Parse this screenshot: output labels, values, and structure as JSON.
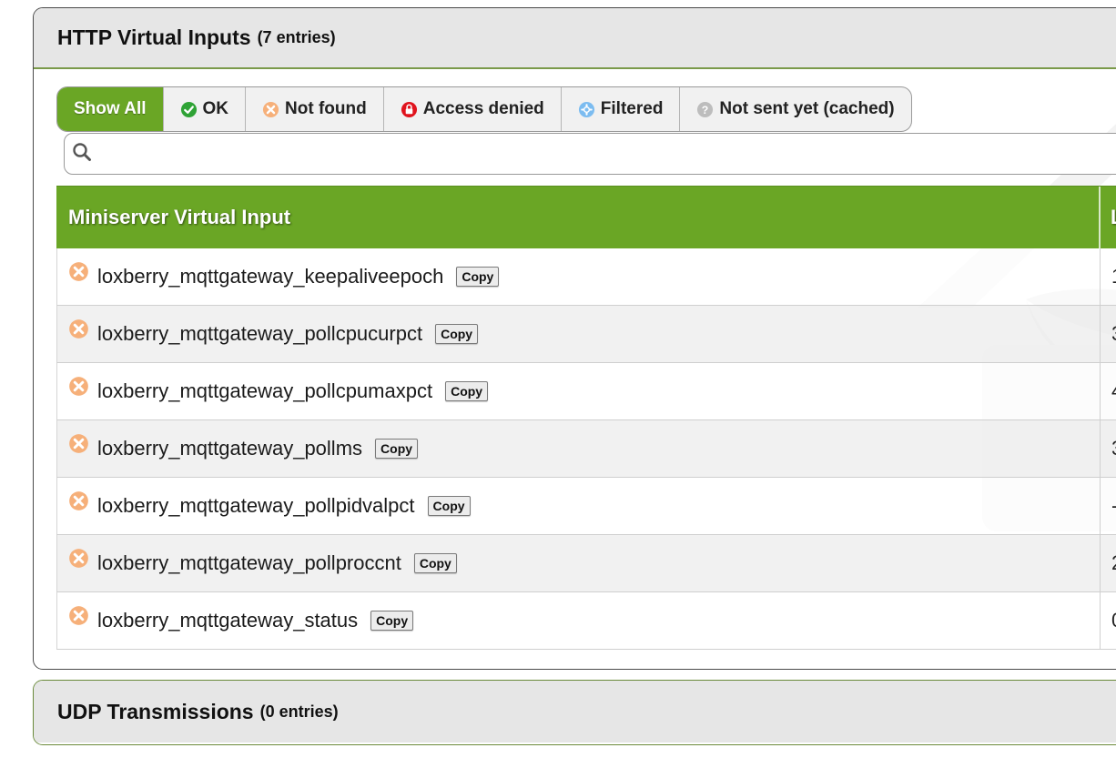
{
  "http_panel": {
    "title": "HTTP Virtual Inputs",
    "count": "(7 entries)"
  },
  "filters": [
    {
      "label": "Show All",
      "icon": "none"
    },
    {
      "label": "OK",
      "icon": "check-icon"
    },
    {
      "label": "Not found",
      "icon": "not-found-icon"
    },
    {
      "label": "Access denied",
      "icon": "lock-icon"
    },
    {
      "label": "Filtered",
      "icon": "filter-icon"
    },
    {
      "label": "Not sent yet (cached)",
      "icon": "question-icon"
    }
  ],
  "search": {
    "placeholder": ""
  },
  "table": {
    "col1": "Miniserver Virtual Input",
    "col2": "L",
    "copy_label": "Copy",
    "rows": [
      {
        "name": "loxberry_mqttgateway_keepaliveepoch",
        "value": "1",
        "status": "not-found"
      },
      {
        "name": "loxberry_mqttgateway_pollcpucurpct",
        "value": "3",
        "status": "not-found"
      },
      {
        "name": "loxberry_mqttgateway_pollcpumaxpct",
        "value": "4",
        "status": "not-found"
      },
      {
        "name": "loxberry_mqttgateway_pollms",
        "value": "3",
        "status": "not-found"
      },
      {
        "name": "loxberry_mqttgateway_pollpidvalpct",
        "value": "-",
        "status": "not-found"
      },
      {
        "name": "loxberry_mqttgateway_pollproccnt",
        "value": "2",
        "status": "not-found"
      },
      {
        "name": "loxberry_mqttgateway_status",
        "value": "0",
        "status": "not-found"
      }
    ]
  },
  "udp_panel": {
    "title": "UDP Transmissions",
    "count": "(0 entries)"
  },
  "colors": {
    "accent": "#6aa625",
    "not_found": "#f4a460",
    "ok": "#2fa336",
    "denied": "#e0141e",
    "filtered": "#5aa7e8",
    "cached": "#b3b3b3"
  }
}
